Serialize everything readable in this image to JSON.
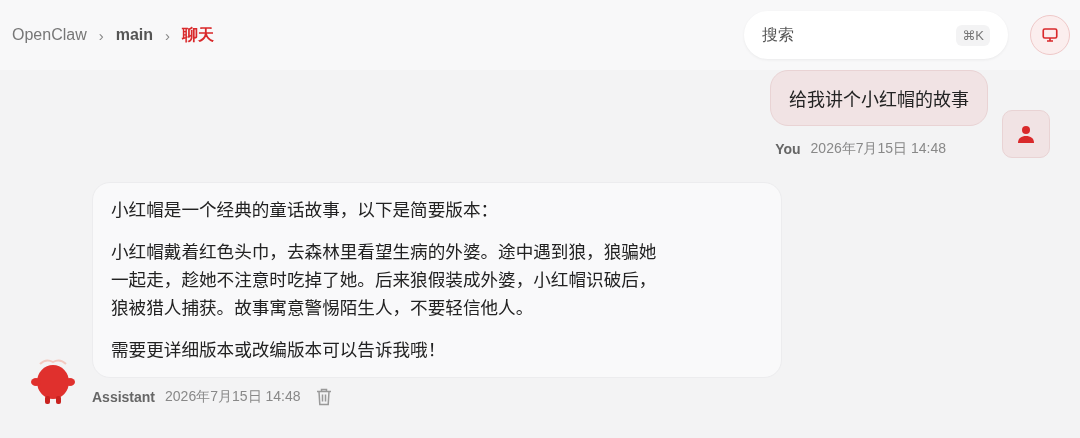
{
  "breadcrumb": [
    {
      "label": "OpenClaw",
      "selected": false
    },
    {
      "label": "main",
      "selected": false
    },
    {
      "label": "聊天",
      "selected": true
    }
  ],
  "breadcrumb_separator": "›",
  "search": {
    "placeholder": "搜索",
    "shortcut": "⌘K"
  },
  "messages": [
    {
      "kind": "user",
      "author": "You",
      "time": "2026年7月15日 14:48",
      "paragraphs": [
        "给我讲个小红帽的故事"
      ]
    },
    {
      "kind": "assistant",
      "author": "Assistant",
      "time": "2026年7月15日 14:48",
      "paragraphs": [
        "小红帽是一个经典的童话故事，以下是简要版本：",
        "小红帽戴着红色头巾，去森林里看望生病的外婆。途中遇到狼，狼骗她一起走，趁她不注意时吃掉了她。后来狼假装成外婆，小红帽识破后，狼被猎人捕获。故事寓意警惕陌生人，不要轻信他人。",
        "需要更详细版本或改编版本可以告诉我哦！"
      ]
    }
  ]
}
